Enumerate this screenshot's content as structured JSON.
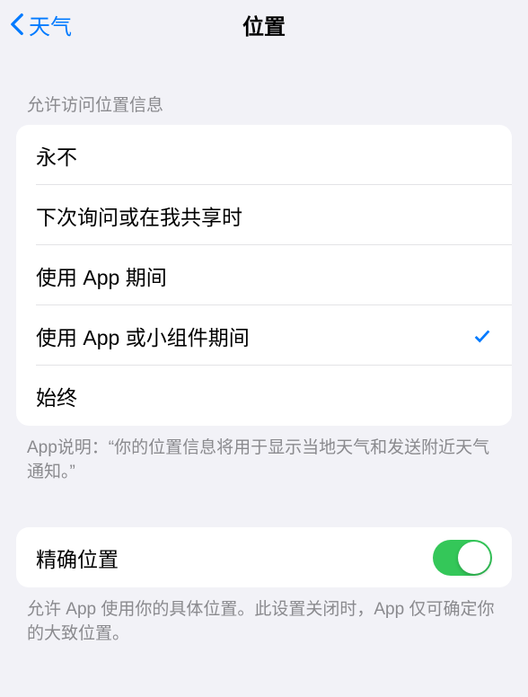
{
  "nav": {
    "back_label": "天气",
    "title": "位置"
  },
  "section1": {
    "header": "允许访问位置信息",
    "items": [
      {
        "label": "永不",
        "selected": false
      },
      {
        "label": "下次询问或在我共享时",
        "selected": false
      },
      {
        "label": "使用 App 期间",
        "selected": false
      },
      {
        "label": "使用 App 或小组件期间",
        "selected": true
      },
      {
        "label": "始终",
        "selected": false
      }
    ],
    "footer": "App说明：“你的位置信息将用于显示当地天气和发送附近天气通知。”"
  },
  "section2": {
    "label": "精确位置",
    "toggle_on": true,
    "footer": "允许 App 使用你的具体位置。此设置关闭时，App 仅可确定你的大致位置。"
  }
}
